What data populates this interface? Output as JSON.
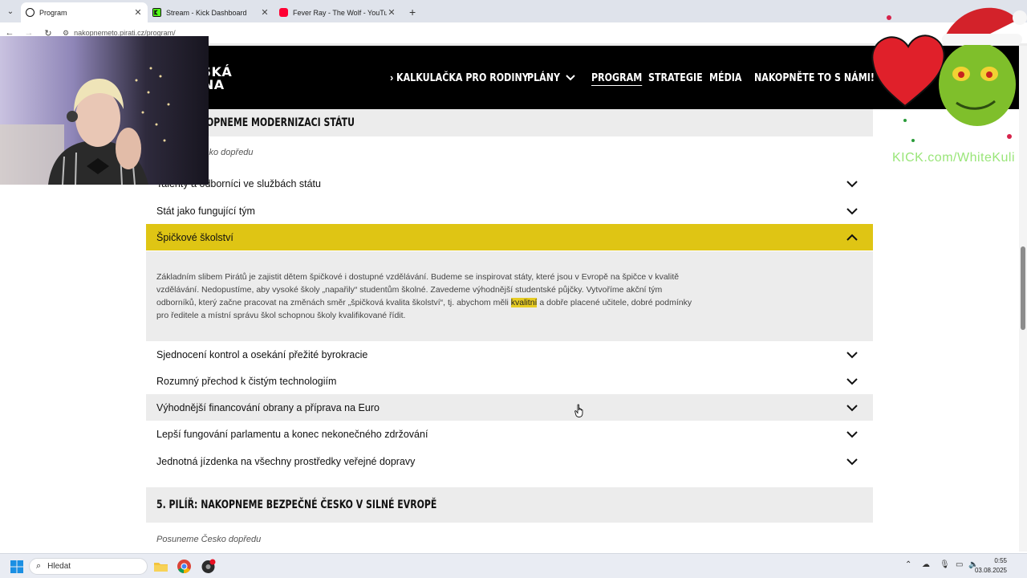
{
  "browser": {
    "tabs": [
      {
        "title": "Program",
        "active": true,
        "favicon_color": "#111111"
      },
      {
        "title": "Stream - Kick Dashboard",
        "active": false,
        "favicon_color": "#53fc18"
      },
      {
        "title": "Fever Ray - The Wolf - YouTube",
        "active": false,
        "favicon_color": "#ff0033"
      }
    ],
    "tab_close": "✕",
    "new_tab": "+",
    "url": "nakopnemeto.pirati.cz/program/"
  },
  "site": {
    "logo_line1": "TSKÁ",
    "logo_line2": "ANA",
    "nav": {
      "calculator": "KALKULAČKA PRO RODINY",
      "plans": "PLÁNY",
      "program": "PROGRAM",
      "strategy": "STRATEGIE",
      "media": "MÉDIA",
      "join": "NAKOPNĚTE TO S NÁMI!"
    }
  },
  "content": {
    "section4_title": "OPNEME MODERNIZACI STÁTU",
    "section4_subtitle": "sko dopředu",
    "items_before": [
      "Talenty a odborníci ve službách státu",
      "Stát jako fungující tým"
    ],
    "open_item": {
      "title": "Špičkové školství",
      "body_before": "Základním slibem Pirátů je zajistit dětem špičkové i dostupné vzdělávání. Budeme se inspirovat státy, které jsou v Evropě na špičce v kvalitě vzdělávání. Nedopustíme, aby vysoké školy „napařily“ studentům školné. Zavedeme výhodnější studentské půjčky. Vytvoříme akční tým odborníků, který začne pracovat na změnách směr „špičková kvalita školství“, tj. abychom měli ",
      "body_highlight": "kvalitní",
      "body_after": " a dobře placené učitele, dobré podmínky pro ředitele a místní správu škol schopnou školy kvalifikované řídit."
    },
    "items_after": [
      "Sjednocení kontrol a osekání přežité byrokracie",
      "Rozumný přechod k čistým technologiím",
      "Výhodnější financování obrany a příprava na Euro",
      "Lepší fungování parlamentu a konec nekonečného zdržování",
      "Jednotná jízdenka na všechny prostředky veřejné dopravy"
    ],
    "section5_title": "5. PILÍŘ: NAKOPNEME BEZPEČNÉ ČESKO V SILNÉ EVROPĚ",
    "section5_subtitle": "Posuneme Česko dopředu"
  },
  "overlay": {
    "kick_url": "KICK.com/WhiteKuli"
  },
  "taskbar": {
    "search_placeholder": "Hledat",
    "time": "0:55",
    "date": "03.08.2025"
  },
  "colors": {
    "accent_yellow": "#dfc514",
    "header_black": "#000000",
    "row_gray": "#ececec",
    "kick_green": "#8ee36a"
  }
}
